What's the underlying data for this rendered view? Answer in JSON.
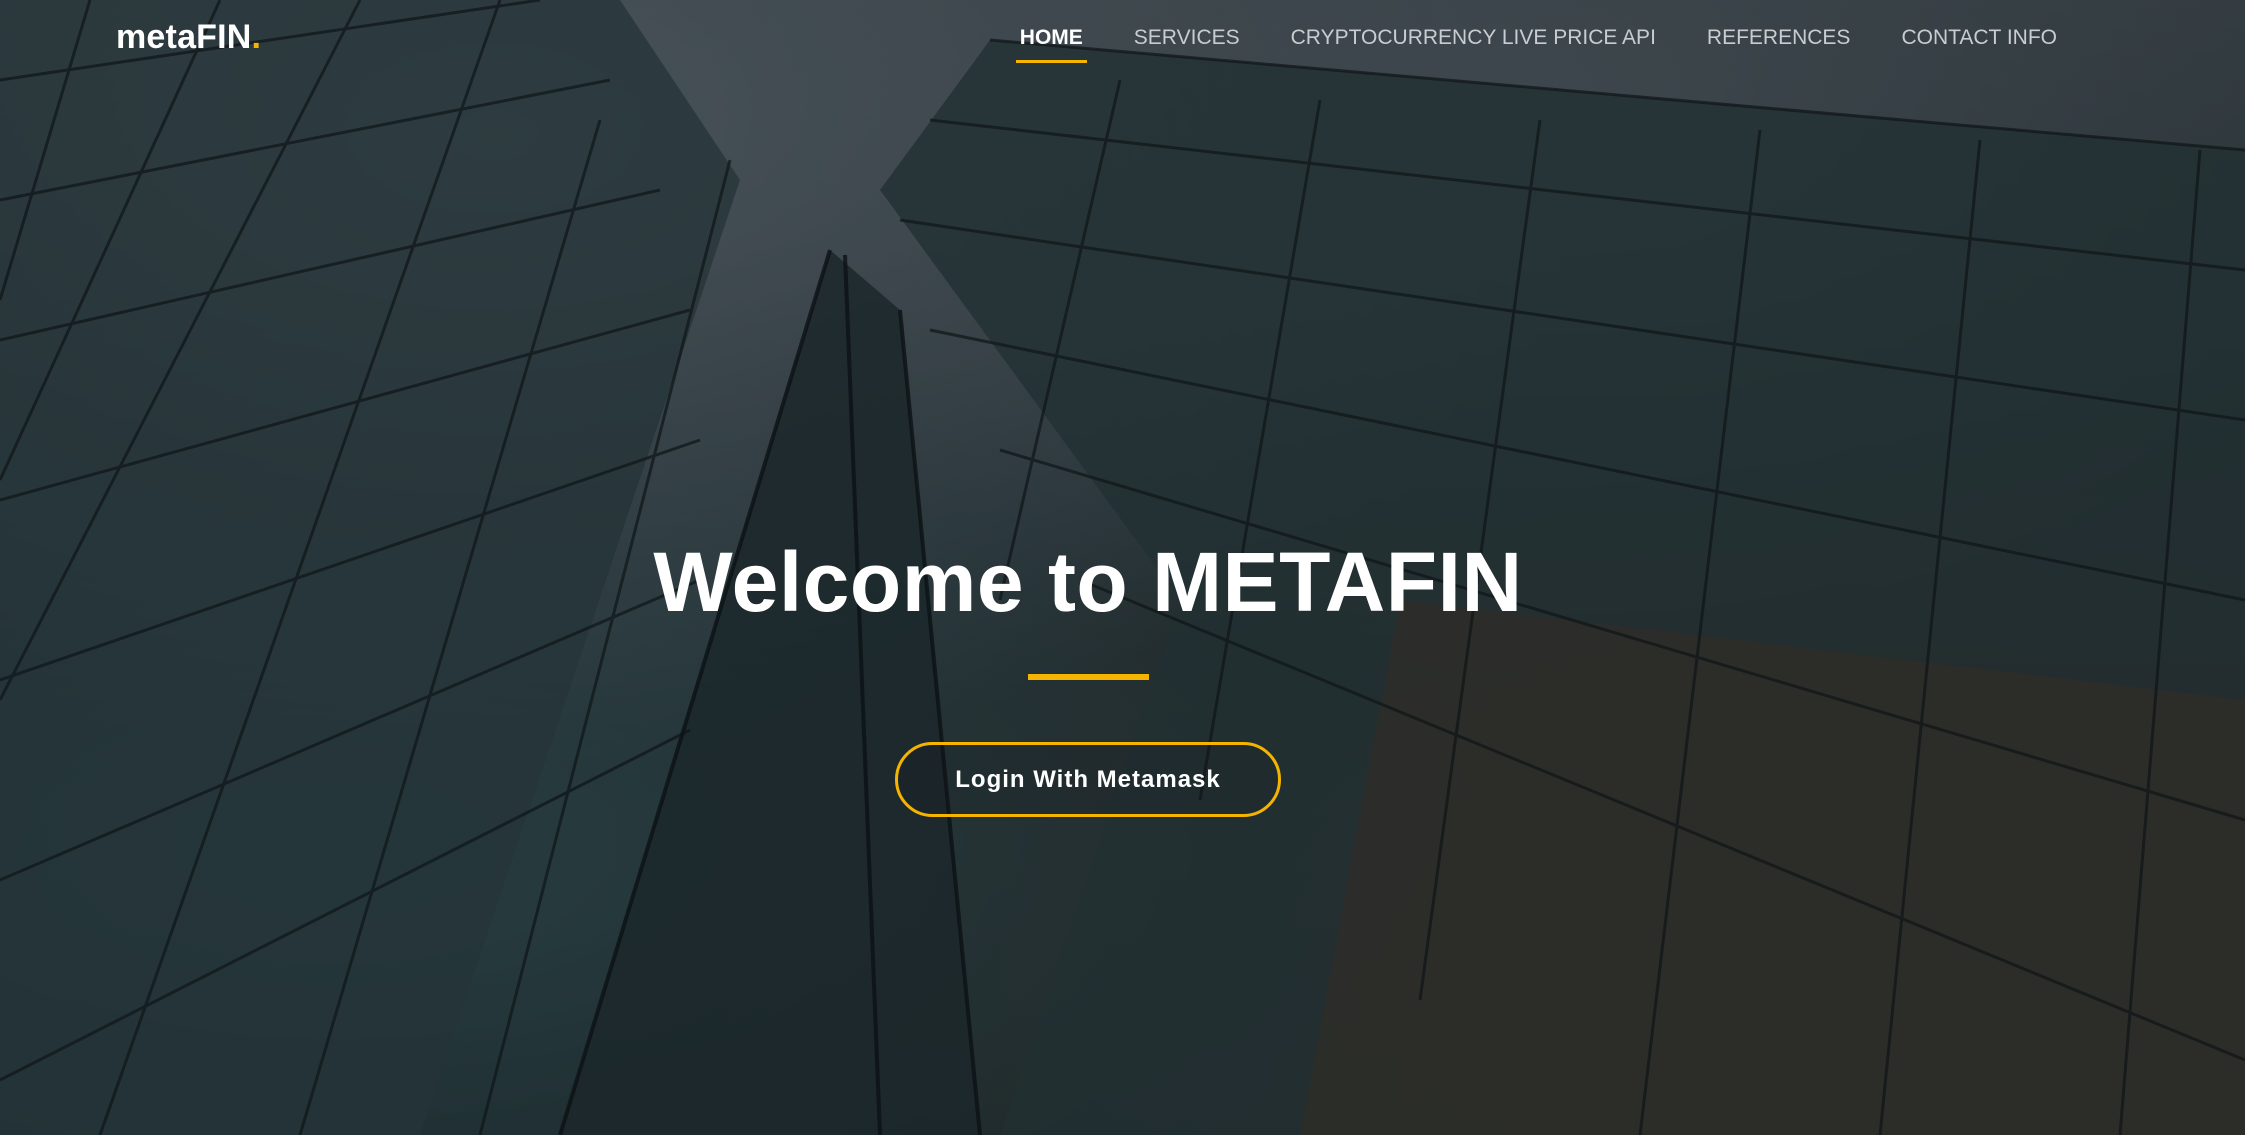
{
  "header": {
    "logo_main": "metaFIN",
    "logo_dot": "."
  },
  "nav": {
    "items": [
      {
        "label": "HOME",
        "active": true
      },
      {
        "label": "SERVICES",
        "active": false
      },
      {
        "label": "CRYPTOCURRENCY LIVE PRICE API",
        "active": false
      },
      {
        "label": "REFERENCES",
        "active": false
      },
      {
        "label": "CONTACT INFO",
        "active": false
      }
    ]
  },
  "hero": {
    "title": "Welcome to METAFIN",
    "cta_label": "Login With Metamask",
    "background": "glass-skyscrapers-photo"
  },
  "colors": {
    "accent": "#f4b400",
    "text": "#ffffff",
    "nav_text": "#c9cdcf"
  }
}
